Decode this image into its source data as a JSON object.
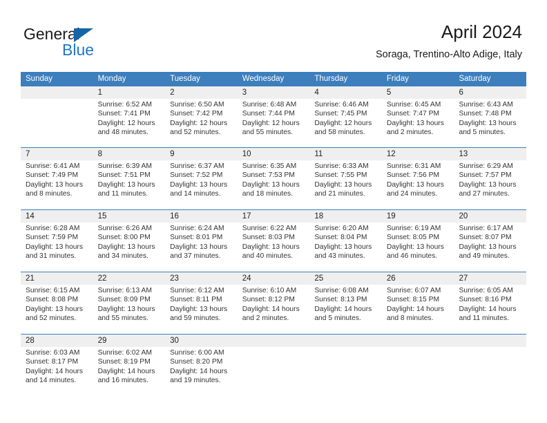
{
  "brand": {
    "name_top": "General",
    "name_bottom": "Blue",
    "triangle_color": "#1565a8",
    "blue_color": "#1f77c4"
  },
  "header": {
    "title": "April 2024",
    "subtitle": "Soraga, Trentino-Alto Adige, Italy"
  },
  "colors": {
    "header_row_bg": "#3d7ebc",
    "header_row_text": "#ffffff",
    "daynum_band_bg": "#efefef",
    "separator": "#3d7ebc",
    "body_text": "#333333"
  },
  "weekdays": [
    "Sunday",
    "Monday",
    "Tuesday",
    "Wednesday",
    "Thursday",
    "Friday",
    "Saturday"
  ],
  "weeks": [
    [
      {
        "day": "",
        "sunrise": "",
        "sunset": "",
        "daylight": ""
      },
      {
        "day": "1",
        "sunrise": "Sunrise: 6:52 AM",
        "sunset": "Sunset: 7:41 PM",
        "daylight": "Daylight: 12 hours and 48 minutes."
      },
      {
        "day": "2",
        "sunrise": "Sunrise: 6:50 AM",
        "sunset": "Sunset: 7:42 PM",
        "daylight": "Daylight: 12 hours and 52 minutes."
      },
      {
        "day": "3",
        "sunrise": "Sunrise: 6:48 AM",
        "sunset": "Sunset: 7:44 PM",
        "daylight": "Daylight: 12 hours and 55 minutes."
      },
      {
        "day": "4",
        "sunrise": "Sunrise: 6:46 AM",
        "sunset": "Sunset: 7:45 PM",
        "daylight": "Daylight: 12 hours and 58 minutes."
      },
      {
        "day": "5",
        "sunrise": "Sunrise: 6:45 AM",
        "sunset": "Sunset: 7:47 PM",
        "daylight": "Daylight: 13 hours and 2 minutes."
      },
      {
        "day": "6",
        "sunrise": "Sunrise: 6:43 AM",
        "sunset": "Sunset: 7:48 PM",
        "daylight": "Daylight: 13 hours and 5 minutes."
      }
    ],
    [
      {
        "day": "7",
        "sunrise": "Sunrise: 6:41 AM",
        "sunset": "Sunset: 7:49 PM",
        "daylight": "Daylight: 13 hours and 8 minutes."
      },
      {
        "day": "8",
        "sunrise": "Sunrise: 6:39 AM",
        "sunset": "Sunset: 7:51 PM",
        "daylight": "Daylight: 13 hours and 11 minutes."
      },
      {
        "day": "9",
        "sunrise": "Sunrise: 6:37 AM",
        "sunset": "Sunset: 7:52 PM",
        "daylight": "Daylight: 13 hours and 14 minutes."
      },
      {
        "day": "10",
        "sunrise": "Sunrise: 6:35 AM",
        "sunset": "Sunset: 7:53 PM",
        "daylight": "Daylight: 13 hours and 18 minutes."
      },
      {
        "day": "11",
        "sunrise": "Sunrise: 6:33 AM",
        "sunset": "Sunset: 7:55 PM",
        "daylight": "Daylight: 13 hours and 21 minutes."
      },
      {
        "day": "12",
        "sunrise": "Sunrise: 6:31 AM",
        "sunset": "Sunset: 7:56 PM",
        "daylight": "Daylight: 13 hours and 24 minutes."
      },
      {
        "day": "13",
        "sunrise": "Sunrise: 6:29 AM",
        "sunset": "Sunset: 7:57 PM",
        "daylight": "Daylight: 13 hours and 27 minutes."
      }
    ],
    [
      {
        "day": "14",
        "sunrise": "Sunrise: 6:28 AM",
        "sunset": "Sunset: 7:59 PM",
        "daylight": "Daylight: 13 hours and 31 minutes."
      },
      {
        "day": "15",
        "sunrise": "Sunrise: 6:26 AM",
        "sunset": "Sunset: 8:00 PM",
        "daylight": "Daylight: 13 hours and 34 minutes."
      },
      {
        "day": "16",
        "sunrise": "Sunrise: 6:24 AM",
        "sunset": "Sunset: 8:01 PM",
        "daylight": "Daylight: 13 hours and 37 minutes."
      },
      {
        "day": "17",
        "sunrise": "Sunrise: 6:22 AM",
        "sunset": "Sunset: 8:03 PM",
        "daylight": "Daylight: 13 hours and 40 minutes."
      },
      {
        "day": "18",
        "sunrise": "Sunrise: 6:20 AM",
        "sunset": "Sunset: 8:04 PM",
        "daylight": "Daylight: 13 hours and 43 minutes."
      },
      {
        "day": "19",
        "sunrise": "Sunrise: 6:19 AM",
        "sunset": "Sunset: 8:05 PM",
        "daylight": "Daylight: 13 hours and 46 minutes."
      },
      {
        "day": "20",
        "sunrise": "Sunrise: 6:17 AM",
        "sunset": "Sunset: 8:07 PM",
        "daylight": "Daylight: 13 hours and 49 minutes."
      }
    ],
    [
      {
        "day": "21",
        "sunrise": "Sunrise: 6:15 AM",
        "sunset": "Sunset: 8:08 PM",
        "daylight": "Daylight: 13 hours and 52 minutes."
      },
      {
        "day": "22",
        "sunrise": "Sunrise: 6:13 AM",
        "sunset": "Sunset: 8:09 PM",
        "daylight": "Daylight: 13 hours and 55 minutes."
      },
      {
        "day": "23",
        "sunrise": "Sunrise: 6:12 AM",
        "sunset": "Sunset: 8:11 PM",
        "daylight": "Daylight: 13 hours and 59 minutes."
      },
      {
        "day": "24",
        "sunrise": "Sunrise: 6:10 AM",
        "sunset": "Sunset: 8:12 PM",
        "daylight": "Daylight: 14 hours and 2 minutes."
      },
      {
        "day": "25",
        "sunrise": "Sunrise: 6:08 AM",
        "sunset": "Sunset: 8:13 PM",
        "daylight": "Daylight: 14 hours and 5 minutes."
      },
      {
        "day": "26",
        "sunrise": "Sunrise: 6:07 AM",
        "sunset": "Sunset: 8:15 PM",
        "daylight": "Daylight: 14 hours and 8 minutes."
      },
      {
        "day": "27",
        "sunrise": "Sunrise: 6:05 AM",
        "sunset": "Sunset: 8:16 PM",
        "daylight": "Daylight: 14 hours and 11 minutes."
      }
    ],
    [
      {
        "day": "28",
        "sunrise": "Sunrise: 6:03 AM",
        "sunset": "Sunset: 8:17 PM",
        "daylight": "Daylight: 14 hours and 14 minutes."
      },
      {
        "day": "29",
        "sunrise": "Sunrise: 6:02 AM",
        "sunset": "Sunset: 8:19 PM",
        "daylight": "Daylight: 14 hours and 16 minutes."
      },
      {
        "day": "30",
        "sunrise": "Sunrise: 6:00 AM",
        "sunset": "Sunset: 8:20 PM",
        "daylight": "Daylight: 14 hours and 19 minutes."
      },
      {
        "day": "",
        "sunrise": "",
        "sunset": "",
        "daylight": ""
      },
      {
        "day": "",
        "sunrise": "",
        "sunset": "",
        "daylight": ""
      },
      {
        "day": "",
        "sunrise": "",
        "sunset": "",
        "daylight": ""
      },
      {
        "day": "",
        "sunrise": "",
        "sunset": "",
        "daylight": ""
      }
    ]
  ]
}
